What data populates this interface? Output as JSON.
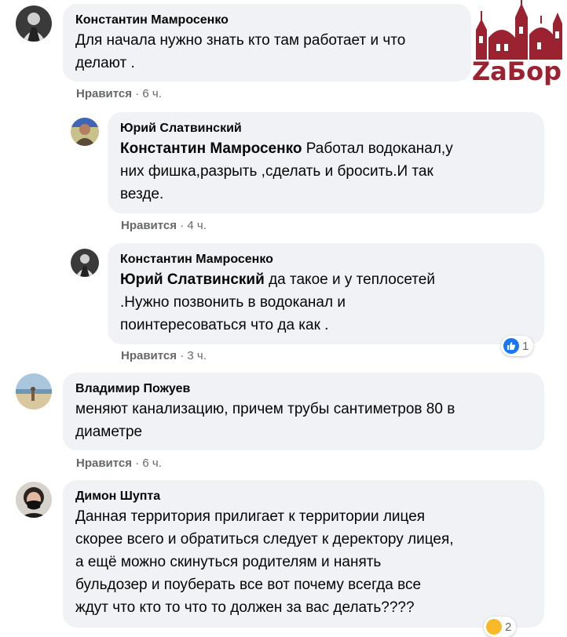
{
  "colors": {
    "bubble": "#f0f2f5",
    "meta": "#65676b",
    "like_blue": "#1877f2",
    "logo_red": "#9b2230"
  },
  "watermark": {
    "text": "ZaБор"
  },
  "comments": [
    {
      "author": "Константин Мамросенко",
      "lines": [
        "Для начала нужно знать кто там работает и что",
        "делают ."
      ],
      "like_label": "Нравится",
      "time": "· 6 ч.",
      "avatar_icon": "person-photo-icon"
    },
    {
      "author": "Юрий Слатвинский",
      "mention": "Константин Мамросенко",
      "lines": [
        "Работал водоканал,у",
        "них фишка,разрыть ,сделать и бросить.И так",
        "везде."
      ],
      "like_label": "Нравится",
      "time": "· 4 ч.",
      "avatar_icon": "person-photo-icon"
    },
    {
      "author": "Константин Мамросенко",
      "mention": "Юрий Слатвинский",
      "lines": [
        "да такое и у теплосетей",
        ".Нужно позвонить в водоканал и",
        "поинтересоваться что да как ."
      ],
      "like_label": "Нравится",
      "time": "· 3 ч.",
      "reaction_count": "1",
      "avatar_icon": "person-photo-icon"
    },
    {
      "author": "Владимир Пожуев",
      "lines": [
        "меняют канализацию, причем трубы сантиметров 80 в",
        "диаметре"
      ],
      "like_label": "Нравится",
      "time": "· 6 ч.",
      "avatar_icon": "beach-photo-icon"
    },
    {
      "author": "Димон Шупта",
      "lines": [
        "Данная территория прилигает к территории лицея",
        "скорее всего и обратиться следует к деректору лицея,",
        "а ещё можно скинуться родителям и нанять",
        "бульдозер и поуберать все вот почему всегда все",
        "ждут что кто то что то должен за вас делать????"
      ],
      "reaction_count": "2",
      "avatar_icon": "masked-person-photo-icon"
    }
  ]
}
